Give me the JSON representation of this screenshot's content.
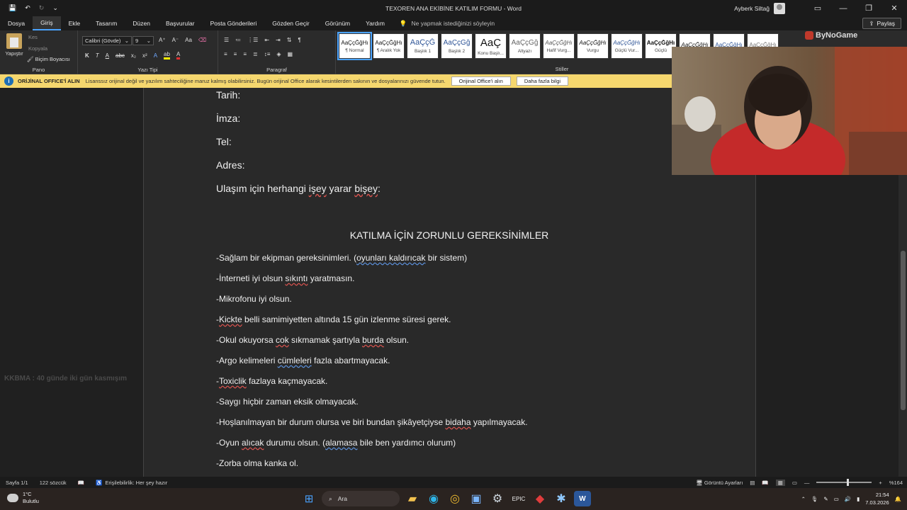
{
  "window": {
    "title": "TEXOREN ANA EKİBİNE KATILIM FORMU  -  Word",
    "user": "Ayberk Siltağ"
  },
  "menu": {
    "items": [
      "Dosya",
      "Giriş",
      "Ekle",
      "Tasarım",
      "Düzen",
      "Başvurular",
      "Posta Gönderileri",
      "Gözden Geçir",
      "Görünüm",
      "Yardım"
    ],
    "tell_me": "Ne yapmak istediğinizi söyleyin",
    "share": "Paylaş"
  },
  "ribbon": {
    "clipboard": {
      "label": "Pano",
      "paste": "Yapıştır",
      "cut": "Kes",
      "copy": "Kopyala",
      "format_painter": "Biçim Boyacısı"
    },
    "font": {
      "label": "Yazı Tipi",
      "name": "Calibri (Gövde)",
      "size": "9"
    },
    "paragraph": {
      "label": "Paragraf"
    },
    "styles": {
      "label": "Stiller",
      "items": [
        {
          "sample": "AaÇçĞğHı",
          "name": "¶ Normal"
        },
        {
          "sample": "AaÇçĞğHı",
          "name": "¶ Aralık Yok"
        },
        {
          "sample": "AaÇçĞ",
          "name": "Başlık 1"
        },
        {
          "sample": "AaÇçĞğ",
          "name": "Başlık 2"
        },
        {
          "sample": "AaÇ",
          "name": "Konu Başlı..."
        },
        {
          "sample": "AaÇçĞğ",
          "name": "Altyazı"
        },
        {
          "sample": "AaÇçĞğHı",
          "name": "Hafif Vurg..."
        },
        {
          "sample": "AaÇçĞğHı",
          "name": "Vurgu"
        },
        {
          "sample": "AaÇçĞğHı",
          "name": "Güçlü Vur..."
        },
        {
          "sample": "AaÇçĞğHı",
          "name": "Güçlü"
        },
        {
          "sample": "AaÇçĞğHı",
          "name": ""
        },
        {
          "sample": "AaÇçĞğHı",
          "name": ""
        },
        {
          "sample": "AaÇçĞğHı",
          "name": ""
        }
      ]
    }
  },
  "infobar": {
    "title": "ORİJİNAL OFFICE'İ ALIN",
    "message": "Lisanssız orijinal değil ve yazılım sahteciliğine maruz kalmış olabilirsiniz. Bugün orijinal Office alarak kesintilerden sakının ve dosyalarınızı güvende tutun.",
    "btn_get": "Orijinal Office'i alın",
    "btn_more": "Daha fazla bilgi"
  },
  "document": {
    "fields": [
      "Tarih:",
      "İmza:",
      "Tel:",
      "Adres:"
    ],
    "transport_prefix": "Ulaşım için herhangi ",
    "transport_w1": "işey",
    "transport_mid": " yarar ",
    "transport_w2": "bişey",
    "transport_suffix": ":",
    "heading": "KATILMA İÇİN ZORUNLU GEREKSİNİMLER",
    "req1_pre": "-Sağlam bir ekipman gereksinimleri. (",
    "req1_u": "oyunları kaldırıcak",
    "req1_post": " bir sistem)",
    "req2_pre": "-İnterneti iyi olsun ",
    "req2_u": "sıkıntı",
    "req2_post": " yaratmasın.",
    "req3": "-Mikrofonu iyi olsun.",
    "req4_pre": "-",
    "req4_u": "Kickte",
    "req4_post": " belli samimiyetten altında 15 gün izlenme süresi gerek.",
    "req5_pre": "-Okul okuyorsa ",
    "req5_u1": "cok",
    "req5_mid": " sıkmamak şartıyla ",
    "req5_u2": "burda",
    "req5_post": " olsun.",
    "req6_pre": "-Argo kelimeleri ",
    "req6_u": "cümleleri",
    "req6_post": " fazla abartmayacak.",
    "req7_pre": "-",
    "req7_u": "Toxiclik",
    "req7_post": " fazlaya kaçmayacak.",
    "req8": "-Saygı hiçbir zaman eksik olmayacak.",
    "req9_pre": "-Hoşlanılmayan bir durum olursa ve biri bundan şikâyetçiyse ",
    "req9_u": "bidaha",
    "req9_post": " yapılmayacak.",
    "req10_pre": "-Oyun ",
    "req10_u1": "alıcak",
    "req10_mid": " durumu olsun. (",
    "req10_u2": "alamasa",
    "req10_post": " bile ben yardımcı olurum)",
    "req11": "-Zorba olma kanka ol.",
    "side_overlay": "KKBMA : 40 günde iki gün kasmışım"
  },
  "stream": {
    "logo": "ByNoGame"
  },
  "status": {
    "page": "Sayfa 1/1",
    "words": "122 sözcük",
    "accessibility": "Erişilebilirlik: Her şey hazır",
    "display_settings": "Görüntü Ayarları",
    "zoom": "%164",
    "zoom_fraction": 0.55
  },
  "taskbar": {
    "temp": "1°C",
    "weather": "Bulutlu",
    "search": "Ara",
    "time": "21:54",
    "date": "7.03.2026"
  },
  "colors": {
    "accent": "#4aa3ff",
    "infobar": "#f5d76e",
    "spell": "#d9534f",
    "grammar": "#5b8fd9"
  }
}
